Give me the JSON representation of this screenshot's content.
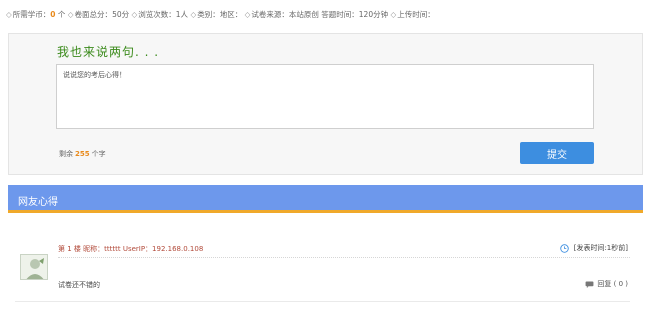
{
  "meta": {
    "items": [
      {
        "label": "所需学币：",
        "value": "0",
        "suffix": " 个"
      },
      {
        "label": "卷面总分：",
        "value": "",
        "suffix": "50分"
      },
      {
        "label": "浏览次数：",
        "value": "",
        "suffix": "1人"
      },
      {
        "label": "类别：",
        "value": "",
        "suffix": "地区："
      },
      {
        "label": "试卷来源：",
        "value": "",
        "suffix": "本站原创 答题时间：120分钟"
      },
      {
        "label": "上传时间：",
        "value": "",
        "suffix": ""
      }
    ],
    "separator": "◇"
  },
  "comment_form": {
    "title": "我也来说两句. . .",
    "placeholder": "说说您的考后心得！",
    "remaining_prefix": "剩余",
    "remaining_count": "255",
    "remaining_suffix": "个字",
    "submit_label": "提交"
  },
  "section": {
    "title": "网友心得"
  },
  "posts": [
    {
      "user_line": "第 1 楼 昵称：tttttt UserIP：192.168.0.108",
      "time": "[发表时间:1秒前]",
      "body": "试卷还不错的",
      "reply_label": "回复",
      "reply_count": "( 0 )"
    }
  ],
  "colors": {
    "accent_blue": "#6d98ec",
    "button_blue": "#3d8ee0",
    "orange": "#f0a92a",
    "title_green": "#3a8a1a",
    "user_red": "#b24a3a"
  }
}
